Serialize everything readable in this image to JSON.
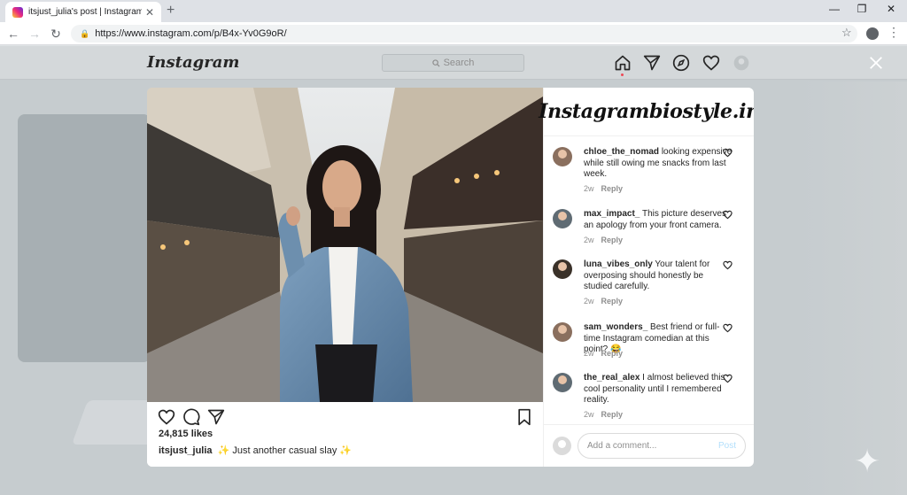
{
  "browser": {
    "tab_title": "itsjust_julia's post | Instagram",
    "tab_close": "✕",
    "new_tab": "+",
    "url": "https://www.instagram.com/p/B4x-Yv0G9oR/",
    "win_minimize": "—",
    "win_restore": "❐",
    "win_close": "✕"
  },
  "instagram": {
    "logo": "Instagram",
    "search_placeholder": "Search"
  },
  "post": {
    "likes": "24,815 likes",
    "caption_user": "itsjust_julia",
    "caption_text": "✨ Just another casual slay ✨"
  },
  "side": {
    "brand": "Instagrambiostyle.in",
    "comments": [
      {
        "user": "chloe_the_nomad",
        "text": "looking expensive while still owing me snacks from last week.",
        "time": "2w",
        "reply": "Reply"
      },
      {
        "user": "max_impact_",
        "text": "This picture deserves an apology from your front camera.",
        "time": "2w",
        "reply": "Reply"
      },
      {
        "user": "luna_vibes_only",
        "text": "Your talent for overposing should honestly be studied carefully.",
        "time": "2w",
        "reply": "Reply"
      },
      {
        "user": "sam_wonders_",
        "text": "Best friend or full-time Instagram comedian at this point? 😂",
        "time": "2w",
        "reply": "Reply"
      },
      {
        "user": "the_real_alex",
        "text": "I almost believed this cool personality until I remembered reality.",
        "time": "2w",
        "reply": "Reply"
      }
    ],
    "add_comment_placeholder": "Add a comment...",
    "post_label": "Post"
  }
}
